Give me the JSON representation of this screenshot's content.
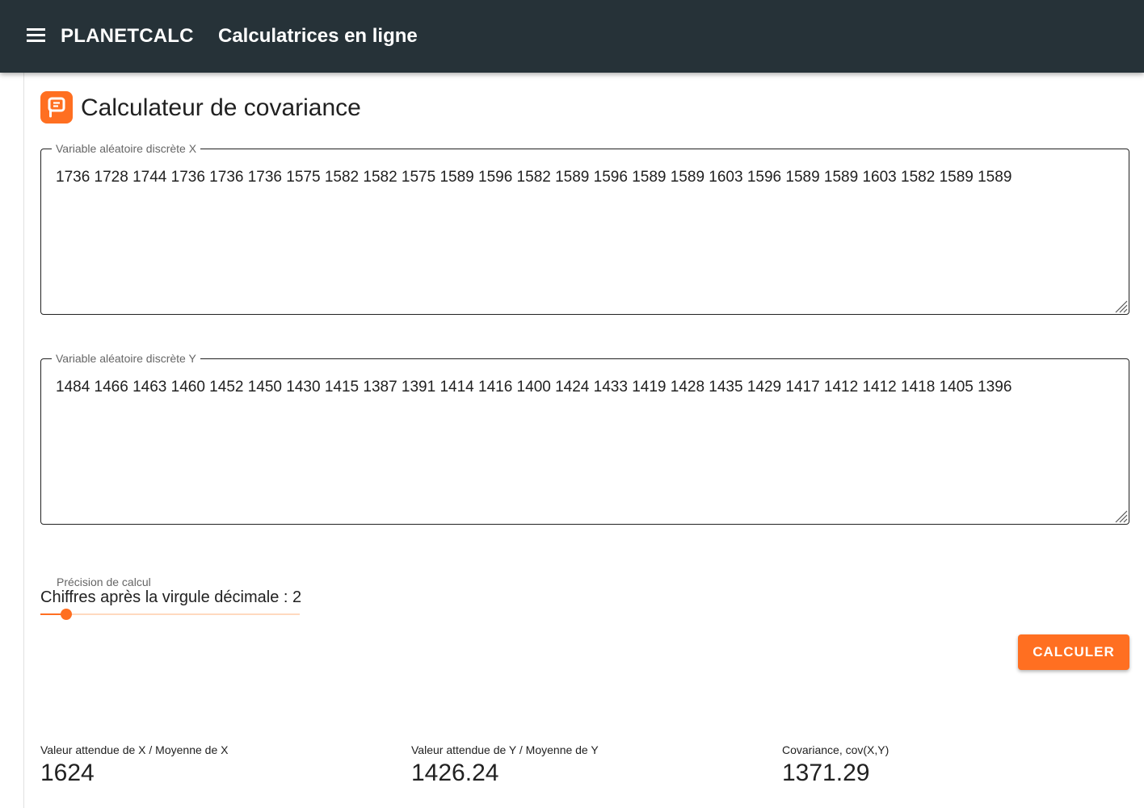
{
  "header": {
    "brand": "PLANETCALC",
    "title": "Calculatrices en ligne"
  },
  "page": {
    "title": "Calculateur de covariance"
  },
  "inputs": {
    "x": {
      "label": "Variable aléatoire discrète X",
      "value": "1736 1728 1744 1736 1736 1736 1575 1582 1582 1575 1589 1596 1582 1589 1596 1589 1589 1603 1596 1589 1589 1603 1582 1589 1589"
    },
    "y": {
      "label": "Variable aléatoire discrète Y",
      "value": "1484 1466 1463 1460 1452 1450 1430 1415 1387 1391 1414 1416 1400 1424 1433 1419 1428 1435 1429 1417 1412 1412 1418 1405 1396"
    }
  },
  "precision": {
    "label": "Précision de calcul",
    "digits_text": "Chiffres après la virgule décimale : 2",
    "digits": 2
  },
  "actions": {
    "calculate_label": "CALCULER"
  },
  "results": {
    "mean_x": {
      "label": "Valeur attendue de X / Moyenne de X",
      "value": "1624"
    },
    "mean_y": {
      "label": "Valeur attendue de Y / Moyenne de Y",
      "value": "1426.24"
    },
    "covariance": {
      "label": "Covariance, cov(X,Y)",
      "value": "1371.29"
    }
  },
  "colors": {
    "appbar": "#263238",
    "accent": "#ff6f21"
  },
  "icons": {
    "menu": "menu-icon",
    "logo": "planetcalc-logo-icon",
    "resize": "resize-grip-icon"
  }
}
